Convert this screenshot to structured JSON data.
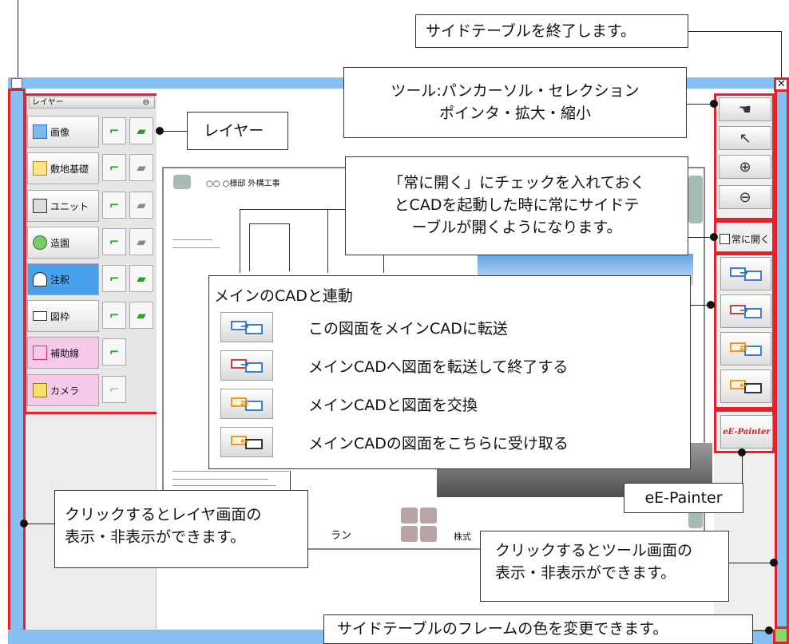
{
  "frame": {
    "color": "#86bff2",
    "highlight": "#e8202a"
  },
  "layer_panel": {
    "title": "レイヤー",
    "pin_icon": "pin-icon",
    "items": [
      {
        "label": "画像",
        "icon": "image-icon",
        "visible": true,
        "editable": true,
        "state": "normal"
      },
      {
        "label": "敷地基礎",
        "icon": "site-icon",
        "visible": true,
        "editable": false,
        "state": "normal"
      },
      {
        "label": "ユニット",
        "icon": "unit-icon",
        "visible": true,
        "editable": false,
        "state": "normal"
      },
      {
        "label": "造園",
        "icon": "tree-icon",
        "visible": true,
        "editable": false,
        "state": "normal"
      },
      {
        "label": "注釈",
        "icon": "north-icon",
        "visible": true,
        "editable": true,
        "state": "active"
      },
      {
        "label": "図枠",
        "icon": "frame-icon",
        "visible": true,
        "editable": true,
        "state": "normal"
      },
      {
        "label": "補助線",
        "icon": "guide-icon",
        "visible": true,
        "editable": null,
        "state": "pink"
      },
      {
        "label": "カメラ",
        "icon": "camera-icon",
        "visible": false,
        "editable": null,
        "state": "pink"
      }
    ]
  },
  "drawing": {
    "title": "○○ ○様邸 外構工事",
    "plan_label": "ラン",
    "company_label": "株式"
  },
  "tool_panel": {
    "tools": [
      "hand-icon",
      "pointer-icon",
      "zoom-in-icon",
      "zoom-out-icon"
    ],
    "always_open_label": "常に開く",
    "always_open_checked": false,
    "epainter_label": "eE-Painter"
  },
  "callouts": {
    "close_side_table": "サイドテーブルを終了します。",
    "tools_line1": "ツール:パンカーソル・セレクション",
    "tools_line2": "ポインタ・拡大・縮小",
    "layer": "レイヤー",
    "always_open_line1": "「常に開く」にチェックを入れておく",
    "always_open_line2": "とCADを起動した時に常にサイドテ",
    "always_open_line3": "ーブルが開くようになります。",
    "main_cad_title": "メインのCADと連動",
    "main_cad_items": [
      "この図面をメインCADに転送",
      "メインCADへ図面を転送して終了する",
      "メインCADと図面を交換",
      "メインCADの図面をこちらに受け取る"
    ],
    "epainter": "eE-Painter",
    "layer_toggle_line1": "クリックするとレイヤ画面の",
    "layer_toggle_line2": "表示・非表示ができます。",
    "tool_toggle_line1": "クリックするとツール画面の",
    "tool_toggle_line2": "表示・非表示ができます。",
    "frame_color": "サイドテーブルのフレームの色を変更できます。"
  }
}
